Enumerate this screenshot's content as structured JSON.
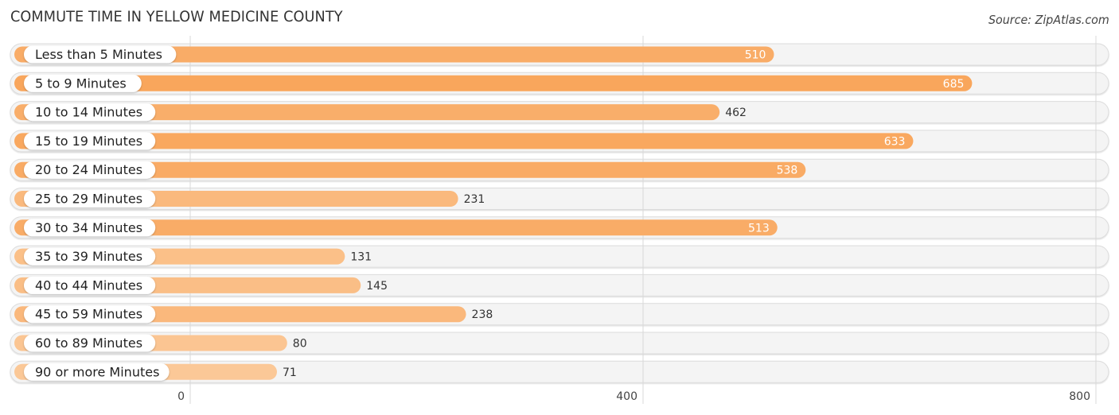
{
  "header": {
    "title": "COMMUTE TIME IN YELLOW MEDICINE COUNTY",
    "source": "Source: ZipAtlas.com"
  },
  "colors": {
    "bar_high": "#f9a65c",
    "bar_low": "#fbc897",
    "track": "#f4f4f4",
    "value_inside": "#ffffff",
    "value_outside": "#333333"
  },
  "chart_data": {
    "type": "bar",
    "orientation": "horizontal",
    "title": "COMMUTE TIME IN YELLOW MEDICINE COUNTY",
    "xlabel": "",
    "ylabel": "",
    "categories": [
      "Less than 5 Minutes",
      "5 to 9 Minutes",
      "10 to 14 Minutes",
      "15 to 19 Minutes",
      "20 to 24 Minutes",
      "25 to 29 Minutes",
      "30 to 34 Minutes",
      "35 to 39 Minutes",
      "40 to 44 Minutes",
      "45 to 59 Minutes",
      "60 to 89 Minutes",
      "90 or more Minutes"
    ],
    "values": [
      510,
      685,
      462,
      633,
      538,
      231,
      513,
      131,
      145,
      238,
      80,
      71
    ],
    "xlim": [
      0,
      800
    ],
    "xticks": [
      0,
      400,
      800
    ],
    "xtick_labels": [
      "0",
      "400",
      "800"
    ],
    "grid": true,
    "legend": "none"
  }
}
